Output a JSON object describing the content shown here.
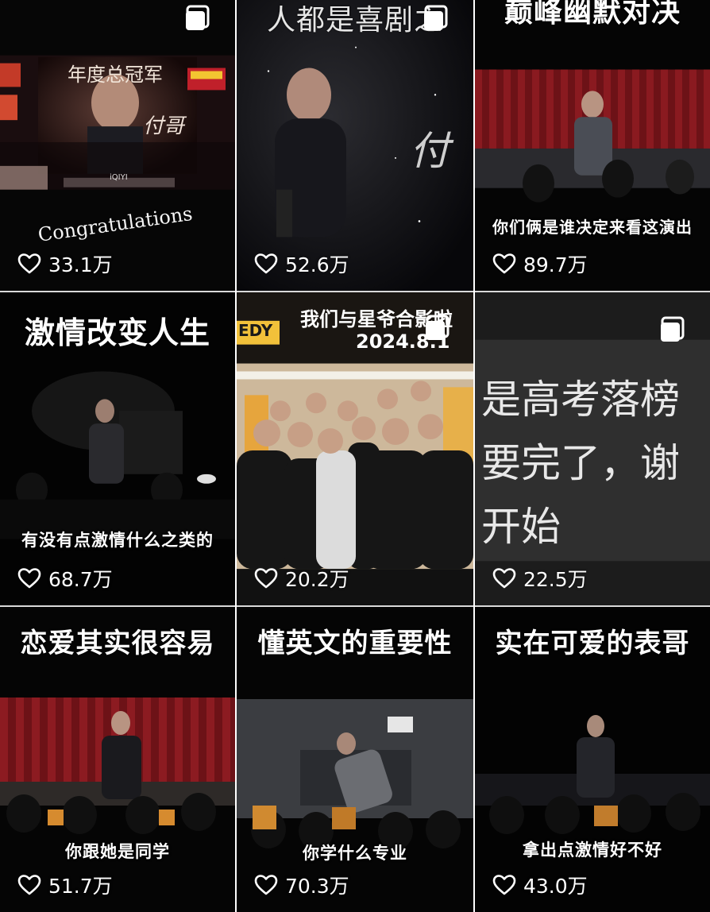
{
  "tiles": [
    {
      "id": 1,
      "title": "",
      "caption": "",
      "overlay": "Congratulations",
      "screen_top": "年度总冠军",
      "screen_sign": "付哥",
      "screen_logo": "iQIYI",
      "likes": "33.1万",
      "multi_image": true
    },
    {
      "id": 2,
      "title": "人都是喜剧之",
      "caption": "",
      "screen_sign": "付",
      "likes": "52.6万",
      "multi_image": true
    },
    {
      "id": 3,
      "title": "巅峰幽默对决",
      "caption": "你们俩是谁决定来看这演出",
      "likes": "89.7万",
      "multi_image": false
    },
    {
      "id": 4,
      "title": "激情改变人生",
      "caption": "有没有点激情什么之类的",
      "likes": "68.7万",
      "multi_image": false
    },
    {
      "id": 5,
      "title": "",
      "banner_line1": "我们与星爷合影啦",
      "banner_line2": "2024.8.1",
      "banner_brand": "EDY",
      "caption": "",
      "likes": "20.2万",
      "multi_image": true
    },
    {
      "id": 6,
      "title": "",
      "text_lines": [
        "是高考落榜",
        "要完了，谢",
        "开始"
      ],
      "caption": "",
      "likes": "22.5万",
      "multi_image": true
    },
    {
      "id": 7,
      "title": "恋爱其实很容易",
      "caption": "你跟她是同学",
      "likes": "51.7万",
      "multi_image": false
    },
    {
      "id": 8,
      "title": "懂英文的重要性",
      "caption": "你学什么专业",
      "likes": "70.3万",
      "multi_image": false
    },
    {
      "id": 9,
      "title": "实在可爱的表哥",
      "caption": "拿出点激情好不好",
      "likes": "43.0万",
      "multi_image": false
    }
  ],
  "icons": {
    "like": "heart-outline-icon",
    "multi": "multi-image-icon"
  },
  "colors": {
    "background": "#050505",
    "curtain": "#7a1518",
    "divider": "#d9d9d9",
    "text": "#ffffff"
  }
}
